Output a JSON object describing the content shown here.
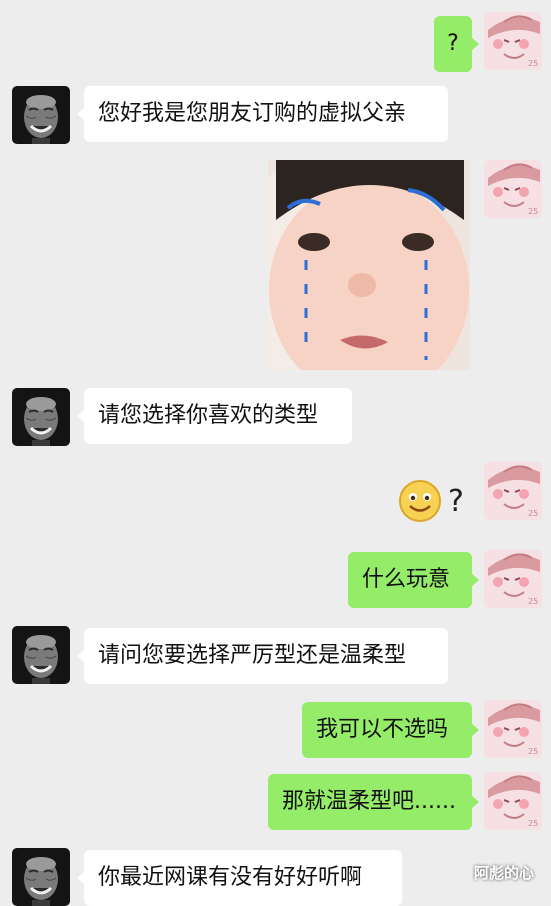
{
  "messages": [
    {
      "side": "right",
      "type": "text",
      "text": "?"
    },
    {
      "side": "left",
      "type": "text",
      "text": "您好我是您朋友订购的虚拟父亲"
    },
    {
      "side": "right",
      "type": "sticker",
      "sticker": "crying-baby-sticker"
    },
    {
      "side": "left",
      "type": "text",
      "text": "请您选择你喜欢的类型"
    },
    {
      "side": "right",
      "type": "emoji",
      "emoji": "smile-emoji",
      "text": "?"
    },
    {
      "side": "right",
      "type": "text",
      "text": "什么玩意"
    },
    {
      "side": "left",
      "type": "text",
      "text": "请问您要选择严厉型还是温柔型"
    },
    {
      "side": "right",
      "type": "text",
      "text": "我可以不选吗"
    },
    {
      "side": "right",
      "type": "text",
      "text": "那就温柔型吧......"
    },
    {
      "side": "left",
      "type": "text",
      "text": "你最近网课有没有好好听啊"
    }
  ],
  "watermark": "阿彪的心",
  "colors": {
    "background": "#ededed",
    "bubble_left": "#ffffff",
    "bubble_right": "#95ec69"
  }
}
